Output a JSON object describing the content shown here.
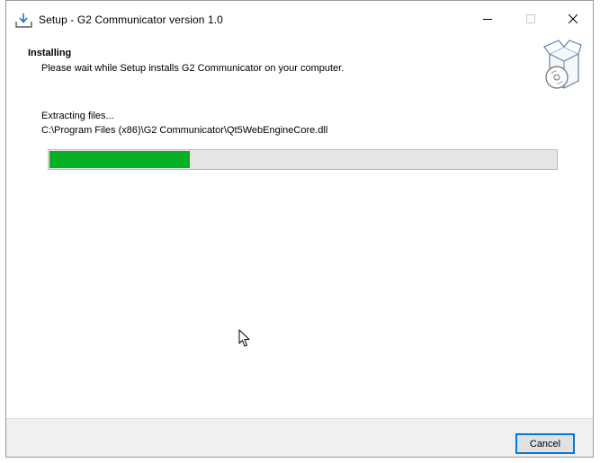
{
  "window": {
    "title": "Setup - G2 Communicator version 1.0",
    "controls": {
      "minimize_icon": "minimize-icon",
      "maximize_icon": "maximize-icon",
      "close_icon": "close-icon"
    }
  },
  "header": {
    "heading": "Installing",
    "subheading": "Please wait while Setup installs G2 Communicator on your computer."
  },
  "body": {
    "status": "Extracting files...",
    "current_file": "C:\\Program Files (x86)\\G2 Communicator\\Qt5WebEngineCore.dll",
    "progress_percent": 28
  },
  "footer": {
    "cancel_label": "Cancel"
  },
  "colors": {
    "progress_fill": "#06b025",
    "progress_track": "#e6e6e6",
    "button_border": "#0078d7",
    "footer_background": "#f0f0f0"
  }
}
